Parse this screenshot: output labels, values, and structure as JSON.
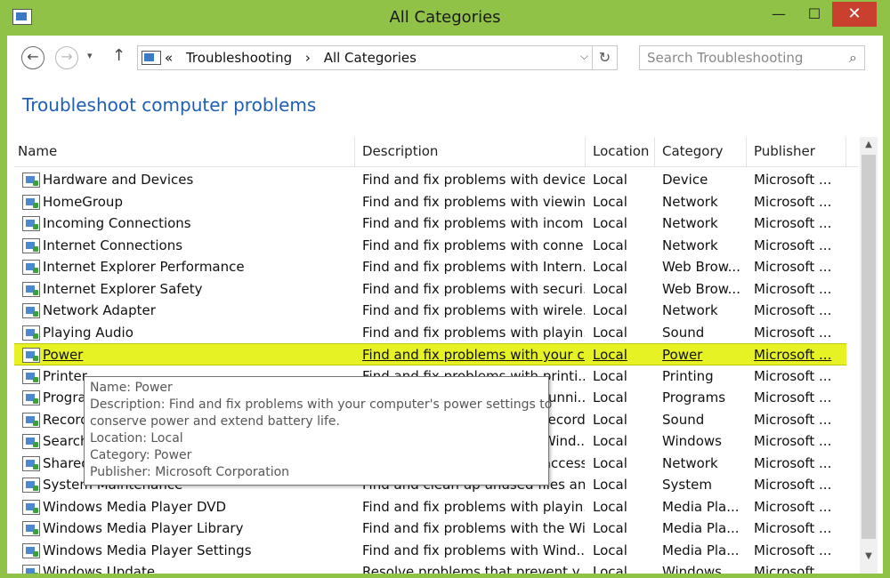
{
  "window": {
    "title": "All Categories",
    "minimize": "—",
    "maximize": "☐",
    "close": "✕"
  },
  "nav": {
    "back": "←",
    "forward": "→",
    "recent": "▾",
    "up": "↑",
    "address_sep": "«",
    "breadcrumb": [
      "Troubleshooting",
      "All Categories"
    ],
    "address_dropdown": "⌵",
    "refresh": "↻",
    "search_placeholder": "Search Troubleshooting"
  },
  "page_title": "Troubleshoot computer problems",
  "table": {
    "columns": [
      "Name",
      "Description",
      "Location",
      "Category",
      "Publisher"
    ],
    "selected_index": 8,
    "rows": [
      {
        "name": "Hardware and Devices",
        "desc": "Find and fix problems with device...",
        "loc": "Local",
        "cat": "Device",
        "pub": "Microsoft ..."
      },
      {
        "name": "HomeGroup",
        "desc": "Find and fix problems with viewin...",
        "loc": "Local",
        "cat": "Network",
        "pub": "Microsoft ..."
      },
      {
        "name": "Incoming Connections",
        "desc": "Find and fix problems with incom...",
        "loc": "Local",
        "cat": "Network",
        "pub": "Microsoft ..."
      },
      {
        "name": "Internet Connections",
        "desc": "Find and fix problems with conne...",
        "loc": "Local",
        "cat": "Network",
        "pub": "Microsoft ..."
      },
      {
        "name": "Internet Explorer Performance",
        "desc": "Find and fix problems with Intern...",
        "loc": "Local",
        "cat": "Web Brow...",
        "pub": "Microsoft ..."
      },
      {
        "name": "Internet Explorer Safety",
        "desc": "Find and fix problems with securi...",
        "loc": "Local",
        "cat": "Web Brow...",
        "pub": "Microsoft ..."
      },
      {
        "name": "Network Adapter",
        "desc": "Find and fix problems with wirele...",
        "loc": "Local",
        "cat": "Network",
        "pub": "Microsoft ..."
      },
      {
        "name": "Playing Audio",
        "desc": "Find and fix problems with playin...",
        "loc": "Local",
        "cat": "Sound",
        "pub": "Microsoft ..."
      },
      {
        "name": "Power",
        "desc": "Find and fix problems with your c...",
        "loc": "Local",
        "cat": "Power",
        "pub": "Microsoft ..."
      },
      {
        "name": "Printer",
        "desc": "Find and fix problems with printi...",
        "loc": "Local",
        "cat": "Printing",
        "pub": "Microsoft ..."
      },
      {
        "name": "Program Compatibility Troubleshooter",
        "desc": "Find and fix problems with runni...",
        "loc": "Local",
        "cat": "Programs",
        "pub": "Microsoft ..."
      },
      {
        "name": "Recording Audio",
        "desc": "Find and fix problems with record...",
        "loc": "Local",
        "cat": "Sound",
        "pub": "Microsoft ..."
      },
      {
        "name": "Search and Indexing",
        "desc": "Find and fix problems with Wind...",
        "loc": "Local",
        "cat": "Windows",
        "pub": "Microsoft ..."
      },
      {
        "name": "Shared Folders",
        "desc": "Find and fix problems with access...",
        "loc": "Local",
        "cat": "Network",
        "pub": "Microsoft ..."
      },
      {
        "name": "System Maintenance",
        "desc": "Find and clean up unused files an...",
        "loc": "Local",
        "cat": "System",
        "pub": "Microsoft ..."
      },
      {
        "name": "Windows Media Player DVD",
        "desc": "Find and fix problems with playin...",
        "loc": "Local",
        "cat": "Media Pla...",
        "pub": "Microsoft ..."
      },
      {
        "name": "Windows Media Player Library",
        "desc": "Find and fix problems with the Wi...",
        "loc": "Local",
        "cat": "Media Pla...",
        "pub": "Microsoft ..."
      },
      {
        "name": "Windows Media Player Settings",
        "desc": "Find and fix problems with Wind...",
        "loc": "Local",
        "cat": "Media Pla...",
        "pub": "Microsoft ..."
      },
      {
        "name": "Windows Update",
        "desc": "Resolve problems that prevent y...",
        "loc": "Local",
        "cat": "Windows",
        "pub": "Microsoft ..."
      }
    ]
  },
  "tooltip": {
    "lines": [
      "Name: Power",
      "Description: Find and fix problems with your computer's power settings to",
      "conserve power and extend battery life.",
      "Location: Local",
      "Category: Power",
      "Publisher: Microsoft Corporation"
    ]
  },
  "scrollbar": {
    "up": "▲",
    "down": "▼"
  },
  "colors": {
    "frame": "#8fc246",
    "selection": "#e6f224",
    "title_link": "#1e5fb4",
    "close_button": "#c9402f"
  }
}
